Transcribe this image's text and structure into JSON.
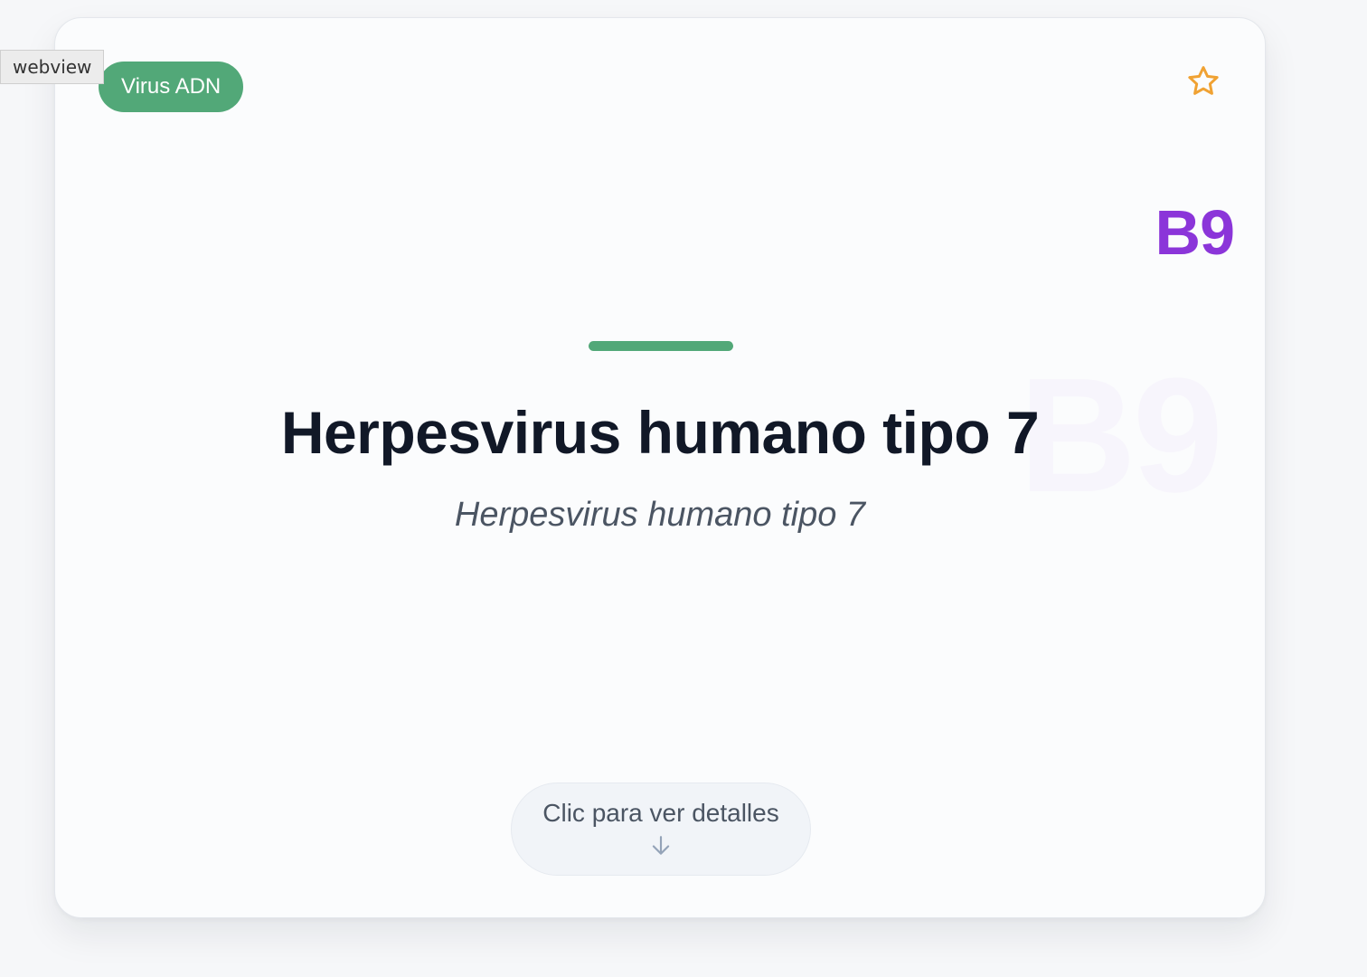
{
  "webview_label": "webview",
  "card": {
    "category_badge": "Virus ADN",
    "code": "B9",
    "watermark_code": "B9",
    "title": "Herpesvirus humano tipo 7",
    "subtitle": "Herpesvirus humano tipo 7",
    "details_button_label": "Clic para ver detalles",
    "favorite_icon": "star-outline-icon",
    "details_icon": "arrow-down-icon"
  },
  "colors": {
    "page_background": "#f6f7f9",
    "card_background": "#fbfcfd",
    "badge_green": "#52a878",
    "code_purple": "#8b35d9",
    "star_orange": "#f0a233",
    "title_text": "#111827",
    "subtitle_text": "#4b5563"
  }
}
